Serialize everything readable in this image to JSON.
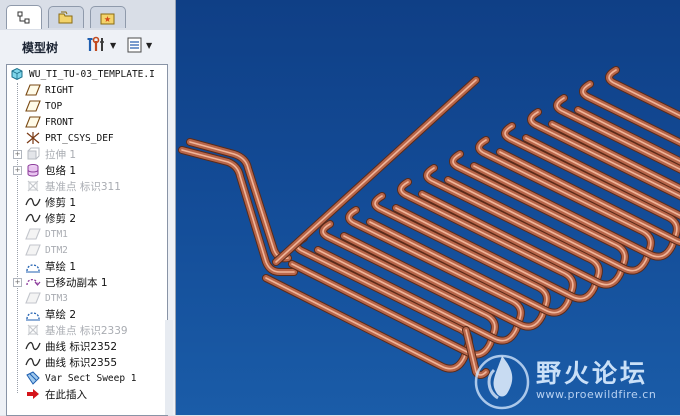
{
  "panel": {
    "title": "模型树",
    "tabs": [
      "model-tree-tab",
      "folder-browser-tab",
      "favorites-tab"
    ]
  },
  "tree": {
    "items": [
      {
        "label": "WU_TI_TU-03_TEMPLATE.I",
        "icon": "part-icon",
        "dim": false,
        "expander": false
      },
      {
        "label": "RIGHT",
        "icon": "datum-plane-icon",
        "dim": false,
        "expander": false
      },
      {
        "label": "TOP",
        "icon": "datum-plane-icon",
        "dim": false,
        "expander": false
      },
      {
        "label": "FRONT",
        "icon": "datum-plane-icon",
        "dim": false,
        "expander": false
      },
      {
        "label": "PRT_CSYS_DEF",
        "icon": "coordinate-system-icon",
        "dim": false,
        "expander": false
      },
      {
        "label": "拉伸 1",
        "icon": "extrude-icon",
        "dim": true,
        "expander": true
      },
      {
        "label": "包络 1",
        "icon": "wrap-icon",
        "dim": false,
        "expander": true
      },
      {
        "label": "基准点 标识311",
        "icon": "datum-point-icon",
        "dim": true,
        "expander": false
      },
      {
        "label": "修剪 1",
        "icon": "curve-icon",
        "dim": false,
        "expander": false
      },
      {
        "label": "修剪 2",
        "icon": "curve-icon",
        "dim": false,
        "expander": false
      },
      {
        "label": "DTM1",
        "icon": "datum-plane-icon",
        "dim": true,
        "expander": false
      },
      {
        "label": "DTM2",
        "icon": "datum-plane-icon",
        "dim": true,
        "expander": false
      },
      {
        "label": "草绘 1",
        "icon": "sketch-icon",
        "dim": false,
        "expander": false
      },
      {
        "label": "已移动副本 1",
        "icon": "moved-copy-icon",
        "dim": false,
        "expander": true
      },
      {
        "label": "DTM3",
        "icon": "datum-plane-icon",
        "dim": true,
        "expander": false
      },
      {
        "label": "草绘 2",
        "icon": "sketch-icon",
        "dim": false,
        "expander": false
      },
      {
        "label": "基准点 标识2339",
        "icon": "datum-point-icon",
        "dim": true,
        "expander": false
      },
      {
        "label": "曲线 标识2352",
        "icon": "curve-icon",
        "dim": false,
        "expander": false
      },
      {
        "label": "曲线 标识2355",
        "icon": "curve-icon",
        "dim": false,
        "expander": false
      },
      {
        "label": "Var Sect Sweep 1",
        "icon": "sweep-icon",
        "dim": false,
        "expander": false
      },
      {
        "label": "在此插入",
        "icon": "insert-here-arrow-icon",
        "dim": false,
        "expander": false
      }
    ]
  },
  "watermark": {
    "title": "野火论坛",
    "url": "www.proewildfire.cn"
  },
  "colors": {
    "viewport_top": "#0f3f86",
    "viewport_bottom": "#1a5ca8",
    "pipe": "#b8664a",
    "pipe_highlight": "#f0b59a"
  }
}
